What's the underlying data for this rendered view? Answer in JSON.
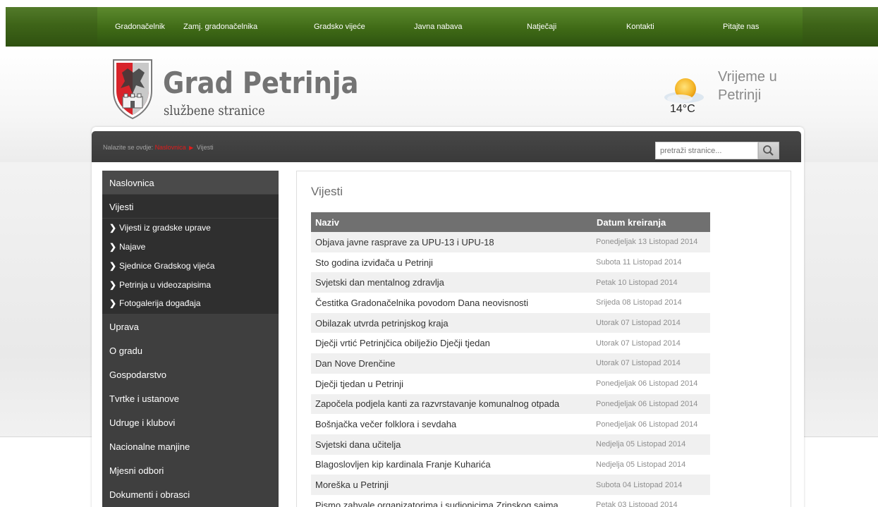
{
  "nav": {
    "items": [
      "Gradonačelnik",
      "Zamj. gradonačelnika",
      "Gradsko vijeće",
      "Javna nabava",
      "Natječaji",
      "Kontakti",
      "Pitajte nas"
    ]
  },
  "logo": {
    "title": "Grad Petrinja",
    "subtitle": "službene stranice",
    "crest_icon": "city-crest-icon"
  },
  "weather": {
    "temperature": "14°C",
    "title": "Vrijeme u Petrinji",
    "icon": "partly-sunny-icon"
  },
  "breadcrumb": {
    "prefix": "Nalazite se ovdje:",
    "home": "Naslovnica",
    "current": "Vijesti"
  },
  "search": {
    "placeholder": "pretraži stranice..."
  },
  "menu": {
    "top_items": [
      "Naslovnica",
      "Vijesti"
    ],
    "sub_items": [
      "Vijesti iz gradske uprave",
      "Najave",
      "Sjednice Gradskog vijeća",
      "Petrinja u videozapisima",
      "Fotogalerija događaja"
    ],
    "bottom_items": [
      "Uprava",
      "O gradu",
      "Gospodarstvo",
      "Tvrtke i ustanove",
      "Udruge i klubovi",
      "Nacionalne manjine",
      "Mjesni odbori",
      "Dokumenti i obrasci"
    ]
  },
  "news": {
    "title": "Vijesti",
    "columns": [
      "Naziv",
      "Datum kreiranja"
    ],
    "rows": [
      {
        "title": "Objava javne rasprave za UPU-13 i UPU-18",
        "date": "Ponedjeljak 13 Listopad 2014"
      },
      {
        "title": "Sto godina izviđača u Petrinji",
        "date": "Subota 11 Listopad 2014"
      },
      {
        "title": "Svjetski dan mentalnog zdravlja",
        "date": "Petak 10 Listopad 2014"
      },
      {
        "title": "Čestitka Gradonačelnika povodom Dana neovisnosti",
        "date": "Srijeda 08 Listopad 2014"
      },
      {
        "title": "Obilazak utvrda petrinjskog kraja",
        "date": "Utorak 07 Listopad 2014"
      },
      {
        "title": "Dječji vrtić Petrinjčica obilježio Dječji tjedan",
        "date": "Utorak 07 Listopad 2014"
      },
      {
        "title": "Dan Nove Drenčine",
        "date": "Utorak 07 Listopad 2014"
      },
      {
        "title": "Dječji tjedan u Petrinji",
        "date": "Ponedjeljak 06 Listopad 2014"
      },
      {
        "title": "Započela podjela kanti za razvrstavanje komunalnog otpada",
        "date": "Ponedjeljak 06 Listopad 2014"
      },
      {
        "title": "Bošnjačka večer folklora i sevdaha",
        "date": "Ponedjeljak 06 Listopad 2014"
      },
      {
        "title": "Svjetski dana učitelja",
        "date": "Nedjelja 05 Listopad 2014"
      },
      {
        "title": "Blagoslovljen kip kardinala Franje Kuharića",
        "date": "Nedjelja 05 Listopad 2014"
      },
      {
        "title": "Moreška u Petrinji",
        "date": "Subota 04 Listopad 2014"
      },
      {
        "title": "Pismo zahvale organizatorima i sudionicima Zrinskog sajma",
        "date": "Petak 03 Listopad 2014"
      }
    ]
  },
  "colors": {
    "nav_green": "#3e6418",
    "breadcrumb_red": "#e21b1b",
    "menu_dark": "#3f3f3f",
    "table_header": "#707070"
  }
}
